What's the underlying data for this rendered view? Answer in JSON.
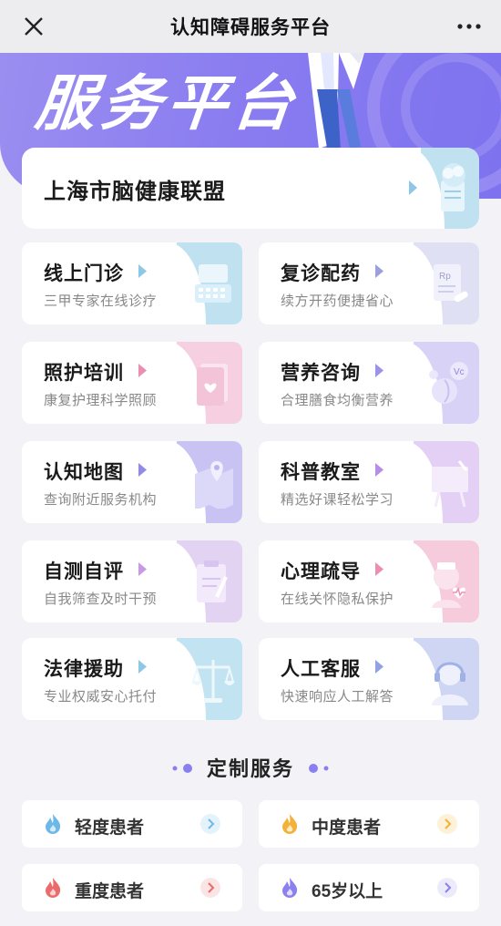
{
  "window": {
    "title": "认知障碍服务平台"
  },
  "banner": {
    "title": "服务平台"
  },
  "featured": {
    "label": "上海市脑健康联盟"
  },
  "services": [
    {
      "title": "线上门诊",
      "subtitle": "三甲专家在线诊疗",
      "icon": "keyboard-icon",
      "color": "#bfe1f0"
    },
    {
      "title": "复诊配药",
      "subtitle": "续方开药便捷省心",
      "icon": "prescription-icon",
      "color": "#dfe0f4"
    },
    {
      "title": "照护培训",
      "subtitle": "康复护理科学照顾",
      "icon": "care-book-icon",
      "color": "#f6cfe0"
    },
    {
      "title": "营养咨询",
      "subtitle": "合理膳食均衡营养",
      "icon": "vitamin-icon",
      "color": "#d7d2f6"
    },
    {
      "title": "认知地图",
      "subtitle": "查询附近服务机构",
      "icon": "map-pin-icon",
      "color": "#c9c3f4"
    },
    {
      "title": "科普教室",
      "subtitle": "精选好课轻松学习",
      "icon": "blackboard-icon",
      "color": "#e5d0f5"
    },
    {
      "title": "自测自评",
      "subtitle": "自我筛查及时干预",
      "icon": "clipboard-icon",
      "color": "#e2d3f3"
    },
    {
      "title": "心理疏导",
      "subtitle": "在线关怀隐私保护",
      "icon": "nurse-heart-icon",
      "color": "#f6cbdc"
    },
    {
      "title": "法律援助",
      "subtitle": "专业权威安心托付",
      "icon": "scales-icon",
      "color": "#c2e3f1"
    },
    {
      "title": "人工客服",
      "subtitle": "快速响应人工解答",
      "icon": "headset-icon",
      "color": "#cfd6f3"
    }
  ],
  "custom_section": {
    "title": "定制服务"
  },
  "custom_items": [
    {
      "label": "轻度患者",
      "icon": "flame-icon",
      "color": "#6cb8e6",
      "chevron_bg": "#e4f2fb"
    },
    {
      "label": "中度患者",
      "icon": "flame-icon",
      "color": "#f2b23a",
      "chevron_bg": "#fdf1d8"
    },
    {
      "label": "重度患者",
      "icon": "flame-icon",
      "color": "#eb6b6b",
      "chevron_bg": "#fbe4e4"
    },
    {
      "label": "65岁以上",
      "icon": "flame-icon",
      "color": "#8c80ee",
      "chevron_bg": "#ecebfb"
    }
  ]
}
